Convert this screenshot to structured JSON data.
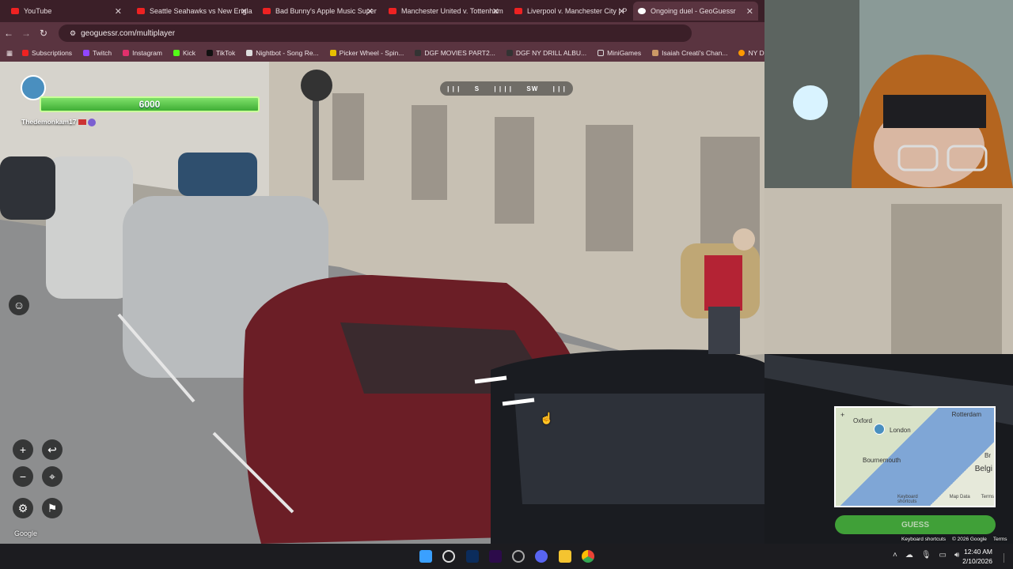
{
  "browser": {
    "tabs": [
      {
        "label": "YouTube",
        "active": false
      },
      {
        "label": "Seattle Seahawks vs New England",
        "active": false
      },
      {
        "label": "Bad Bunny's Apple Music Super",
        "active": false
      },
      {
        "label": "Manchester United v. Tottenham",
        "active": false
      },
      {
        "label": "Liverpool v. Manchester City | P",
        "active": false
      },
      {
        "label": "Ongoing duel - GeoGuessr",
        "active": true
      }
    ],
    "url": "geoguessr.com/multiplayer",
    "bookmarks": [
      "Subscriptions",
      "Twitch",
      "Instagram",
      "Kick",
      "TikTok",
      "Nightbot - Song Re...",
      "Picker Wheel - Spin...",
      "DGF MOVIES PART2...",
      "DGF NY DRILL ALBU...",
      "MiniGames",
      "Isaiah Creati's Chan...",
      "NY Drill Deads Q..."
    ]
  },
  "game": {
    "health": "6000",
    "health_fraction": 1.0,
    "player_name": "Thedemonkam17",
    "compass": [
      "S",
      "SW"
    ],
    "minimap_labels": [
      "Rotterdam",
      "Oxford",
      "London",
      "Bournemouth",
      "Belgi",
      "Br"
    ],
    "minimap_footer": [
      "Keyboard shortcuts",
      "Map Data",
      "Terms"
    ],
    "guess_label": "GUESS",
    "google_logo": "Google",
    "street_footer": [
      "Keyboard shortcuts",
      "© 2026 Google",
      "Terms"
    ]
  },
  "taskbar": {
    "time": "12:40 AM",
    "date": "2/10/2026"
  },
  "colors": {
    "tab_bg": "#3b1f28",
    "toolbar": "#5a3440",
    "health": "#4fc43f",
    "guess": "#48b83d"
  }
}
